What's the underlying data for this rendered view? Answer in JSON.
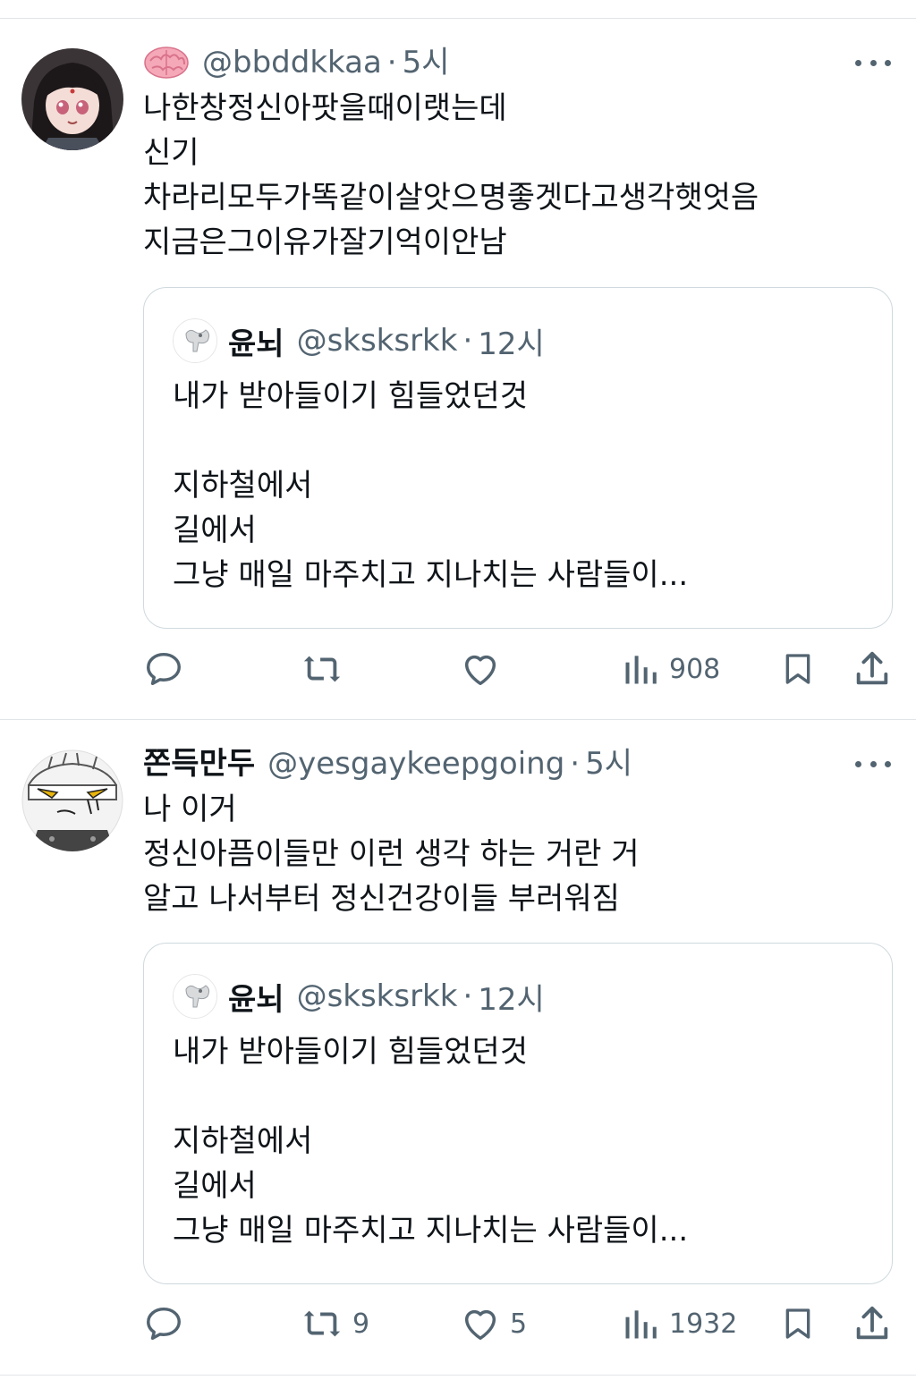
{
  "tweets": [
    {
      "display_name": "",
      "emoji_icon": "brain-emoji",
      "handle": "@bbddkkaa",
      "separator": "·",
      "time": "5시",
      "lines": [
        "나한창정신아팟을때이랫는데",
        "신기",
        "차라리모두가똑같이살앗으명좋겟다고생각햇엇음",
        "지금은그이유가잘기억이안남"
      ],
      "quote": {
        "display_name": "윤뇌",
        "handle": "@sksksrkk",
        "separator": "·",
        "time": "12시",
        "lines": [
          "내가 받아들이기 힘들었던것",
          "",
          "지하철에서",
          "길에서",
          "그냥 매일 마주치고 지나치는 사람들이..."
        ]
      },
      "actions": {
        "reply_count": "",
        "retweet_count": "",
        "like_count": "",
        "views_count": "908"
      }
    },
    {
      "display_name": "쫀득만두",
      "handle": "@yesgaykeepgoing",
      "separator": "·",
      "time": "5시",
      "lines": [
        "나 이거",
        "정신아픔이들만 이런 생각 하는 거란 거",
        "알고 나서부터 정신건강이들 부러워짐"
      ],
      "quote": {
        "display_name": "윤뇌",
        "handle": "@sksksrkk",
        "separator": "·",
        "time": "12시",
        "lines": [
          "내가 받아들이기 힘들었던것",
          "",
          "지하철에서",
          "길에서",
          "그냥 매일 마주치고 지나치는 사람들이..."
        ]
      },
      "actions": {
        "reply_count": "",
        "retweet_count": "9",
        "like_count": "5",
        "views_count": "1932"
      }
    }
  ],
  "colors": {
    "text_primary": "#0f1419",
    "text_secondary": "#536471",
    "border": "#cfd9de",
    "divider": "#e1e5e8"
  }
}
